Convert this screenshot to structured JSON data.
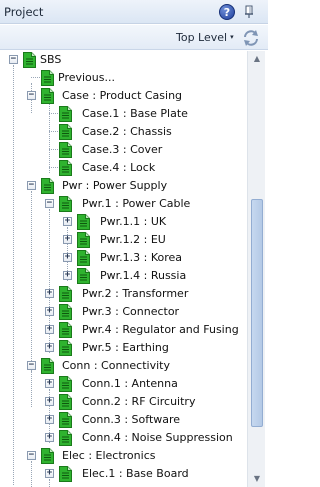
{
  "panel": {
    "title": "Project",
    "help_label": "?",
    "level_label": "Top Level",
    "level_caret": "▾"
  },
  "colors": {
    "doc_icon_green": "#2fb32f",
    "header_bg": "#dbe6f4",
    "scroll_thumb": "#b3c9e6"
  },
  "tree": {
    "root": "SBS",
    "previous": "Previous...",
    "case": {
      "label": "Case : Product Casing",
      "children": [
        "Case.1 : Base Plate",
        "Case.2 : Chassis",
        "Case.3 : Cover",
        "Case.4 : Lock"
      ]
    },
    "pwr": {
      "label": "Pwr : Power Supply",
      "pwr1": {
        "label": "Pwr.1 : Power Cable",
        "children": [
          "Pwr.1.1 : UK",
          "Pwr.1.2 : EU",
          "Pwr.1.3 : Korea",
          "Pwr.1.4 : Russia"
        ]
      },
      "children": [
        "Pwr.2 : Transformer",
        "Pwr.3 : Connector",
        "Pwr.4 : Regulator and Fusing",
        "Pwr.5 : Earthing"
      ]
    },
    "conn": {
      "label": "Conn : Connectivity",
      "children": [
        "Conn.1 : Antenna",
        "Conn.2 : RF Circuitry",
        "Conn.3 : Software",
        "Conn.4 : Noise Suppression"
      ]
    },
    "elec": {
      "label": "Elec : Electronics",
      "children": [
        "Elec.1 : Base Board"
      ]
    }
  }
}
